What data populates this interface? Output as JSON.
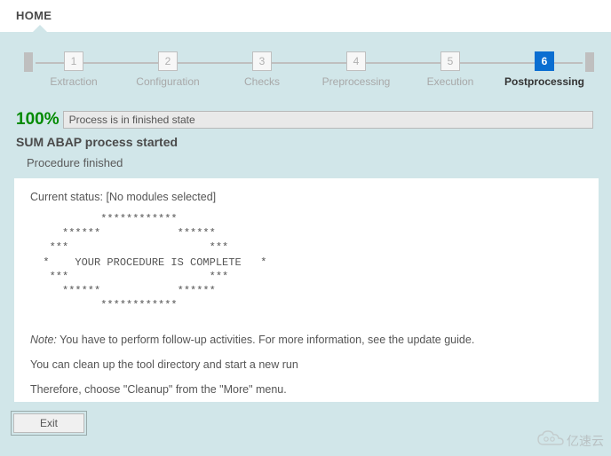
{
  "home": {
    "label": "HOME"
  },
  "stepper": {
    "steps": [
      {
        "num": "1",
        "label": "Extraction"
      },
      {
        "num": "2",
        "label": "Configuration"
      },
      {
        "num": "3",
        "label": "Checks"
      },
      {
        "num": "4",
        "label": "Preprocessing"
      },
      {
        "num": "5",
        "label": "Execution"
      },
      {
        "num": "6",
        "label": "Postprocessing"
      }
    ],
    "active_index": 5
  },
  "progress": {
    "percent": "100%",
    "state_text": "Process is in finished state"
  },
  "subheading": "SUM ABAP process started",
  "procedure_heading": "Procedure finished",
  "content": {
    "status_label": "Current status:",
    "status_value": "[No modules selected]",
    "ascii": "           ************\n     ******            ******\n   ***                      ***\n  *    YOUR PROCEDURE IS COMPLETE   *\n   ***                      ***\n     ******            ******\n           ************",
    "note_label": "Note:",
    "note_text": "You have to perform follow-up activities. For more information, see the update guide.",
    "cleanup_text": "You can clean up the tool directory and start a new run",
    "therefore_text": "Therefore, choose \"Cleanup\" from the \"More\" menu."
  },
  "exit_button": "Exit",
  "watermark": "亿速云"
}
